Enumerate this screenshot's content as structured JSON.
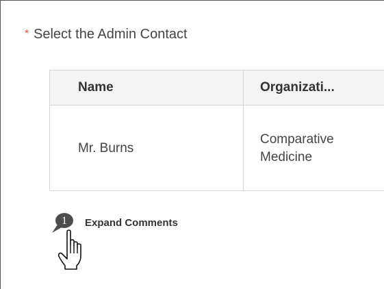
{
  "field": {
    "required_marker": "*",
    "label": "Select the Admin Contact"
  },
  "table": {
    "columns": [
      "Name",
      "Organizati..."
    ],
    "rows": [
      {
        "name": "Mr. Burns",
        "organization": "Comparative Medicine"
      }
    ]
  },
  "comments": {
    "count": "1",
    "label": "Expand Comments",
    "icon": "speech-bubble-icon"
  },
  "cursor": {
    "icon": "hand-pointer-icon"
  },
  "colors": {
    "required": "#d9534f",
    "header_bg": "#f3f3f3",
    "border": "#d4d4d4",
    "bubble": "#4d4d4d"
  }
}
